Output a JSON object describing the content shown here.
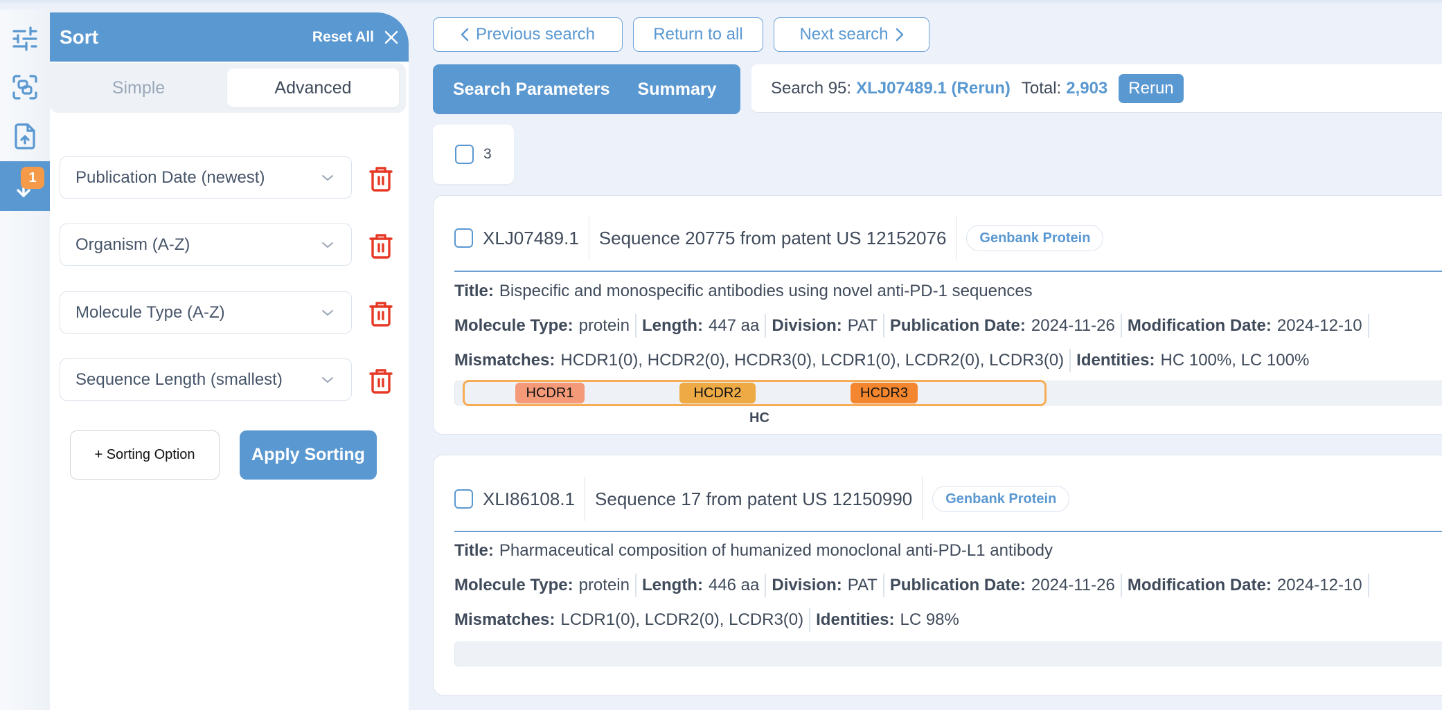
{
  "rail": {
    "items": [
      {
        "icon": "sliders-icon"
      },
      {
        "icon": "scan-compare-icon"
      },
      {
        "icon": "file-upload-icon"
      },
      {
        "icon": "sort-down-icon",
        "badge": "1",
        "active": true
      }
    ]
  },
  "sort_panel": {
    "title": "Sort",
    "reset_label": "Reset All",
    "tabs": {
      "simple": "Simple",
      "advanced": "Advanced",
      "active": "Advanced"
    },
    "options": [
      {
        "label": "Publication Date (newest)"
      },
      {
        "label": "Organism (A-Z)"
      },
      {
        "label": "Molecule Type (A-Z)"
      },
      {
        "label": "Sequence Length (smallest)"
      }
    ],
    "add_label": "+ Sorting Option",
    "apply_label": "Apply Sorting"
  },
  "nav": {
    "previous": "Previous search",
    "return": "Return to all",
    "next": "Next search"
  },
  "tabs": {
    "search_parameters": "Search Parameters",
    "summary": "Summary"
  },
  "summary": {
    "search_prefix": "Search 95:",
    "query": "XLJ07489.1 (Rerun)",
    "total_label": "Total:",
    "total_value": "2,903",
    "rerun_label": "Rerun"
  },
  "select_all": {
    "count": "3"
  },
  "colors": {
    "accent": "#5a98d1",
    "badge": "#f59a48",
    "danger": "#e53925",
    "hcdr1": "#f49a78",
    "hcdr2": "#eeaa44",
    "hcdr3": "#f3862e",
    "chain_outline": "#f6ad55"
  },
  "results": [
    {
      "accession": "XLJ07489.1",
      "description": "Sequence 20775 from patent US 12152076",
      "source": "Genbank Protein",
      "title_label": "Title:",
      "title": "Bispecific and monospecific antibodies using novel anti-PD-1 sequences",
      "fields": [
        {
          "label": "Molecule Type:",
          "value": "protein"
        },
        {
          "label": "Length:",
          "value": "447 aa"
        },
        {
          "label": "Division:",
          "value": "PAT"
        },
        {
          "label": "Publication Date:",
          "value": "2024-11-26"
        },
        {
          "label": "Modification Date:",
          "value": "2024-12-10"
        }
      ],
      "mismatches_label": "Mismatches:",
      "mismatches": "HCDR1(0), HCDR2(0), HCDR3(0), LCDR1(0), LCDR2(0), LCDR3(0)",
      "identities_label": "Identities:",
      "identities": "HC 100%, LC 100%",
      "chain": {
        "label": "HC",
        "regions": [
          {
            "name": "HCDR1"
          },
          {
            "name": "HCDR2"
          },
          {
            "name": "HCDR3"
          }
        ]
      }
    },
    {
      "accession": "XLI86108.1",
      "description": "Sequence 17 from patent US 12150990",
      "source": "Genbank Protein",
      "title_label": "Title:",
      "title": "Pharmaceutical composition of humanized monoclonal anti-PD-L1 antibody",
      "fields": [
        {
          "label": "Molecule Type:",
          "value": "protein"
        },
        {
          "label": "Length:",
          "value": "446 aa"
        },
        {
          "label": "Division:",
          "value": "PAT"
        },
        {
          "label": "Publication Date:",
          "value": "2024-11-26"
        },
        {
          "label": "Modification Date:",
          "value": "2024-12-10"
        }
      ],
      "mismatches_label": "Mismatches:",
      "mismatches": "LCDR1(0), LCDR2(0), LCDR3(0)",
      "identities_label": "Identities:",
      "identities": "LC 98%"
    }
  ]
}
